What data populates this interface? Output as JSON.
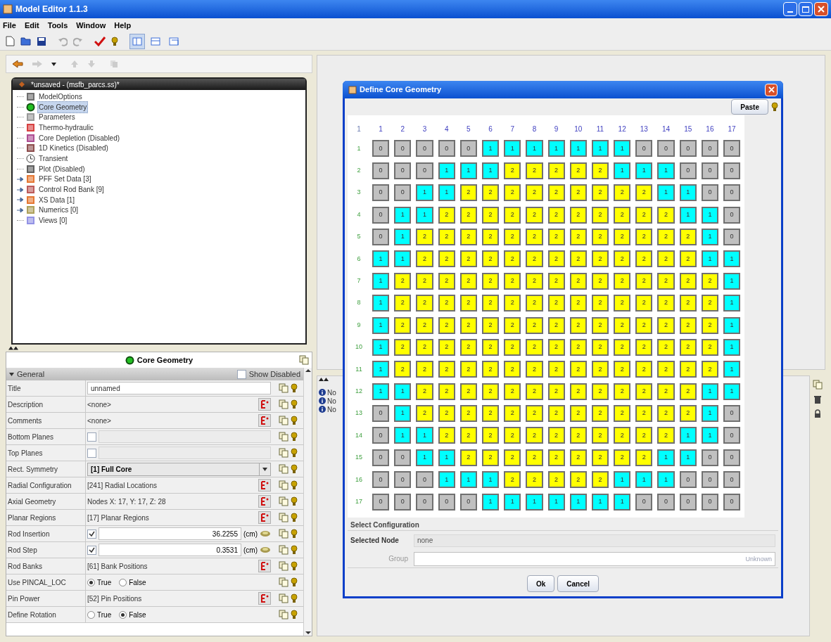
{
  "window": {
    "title": "Model Editor 1.1.3"
  },
  "menu": [
    "File",
    "Edit",
    "Tools",
    "Window",
    "Help"
  ],
  "toolbar": {
    "view_buttons": [
      {
        "selected": true
      },
      {
        "selected": false
      },
      {
        "selected": false
      }
    ]
  },
  "tree": {
    "title": "*unsaved - (msfb_parcs.ss)*",
    "items": [
      {
        "label": "ModelOptions",
        "kind": "leaf",
        "selected": false
      },
      {
        "label": "Core Geometry",
        "kind": "leaf",
        "selected": true
      },
      {
        "label": "Parameters",
        "kind": "leaf",
        "selected": false
      },
      {
        "label": "Thermo-hydraulic",
        "kind": "leaf",
        "selected": false
      },
      {
        "label": "Core Depletion (Disabled)",
        "kind": "leaf",
        "selected": false
      },
      {
        "label": "1D Kinetics (Disabled)",
        "kind": "leaf",
        "selected": false
      },
      {
        "label": "Transient",
        "kind": "leaf",
        "selected": false
      },
      {
        "label": "Plot (Disabled)",
        "kind": "leaf",
        "selected": false
      },
      {
        "label": "PFF Set Data [3]",
        "kind": "group",
        "selected": false
      },
      {
        "label": "Control Rod Bank [9]",
        "kind": "group",
        "selected": false
      },
      {
        "label": "XS Data [1]",
        "kind": "group",
        "selected": false
      },
      {
        "label": "Numerics [0]",
        "kind": "group",
        "selected": false
      },
      {
        "label": "Views [0]",
        "kind": "leaf",
        "selected": false
      }
    ]
  },
  "properties": {
    "title": "Core Geometry",
    "section": "General",
    "show_disabled": {
      "label": "Show Disabled",
      "checked": false
    },
    "rows": [
      {
        "label": "Title",
        "kind": "input",
        "value": "unnamed"
      },
      {
        "label": "Description",
        "kind": "ref",
        "value": "<none>"
      },
      {
        "label": "Comments",
        "kind": "ref",
        "value": "<none>"
      },
      {
        "label": "Bottom Planes",
        "kind": "check",
        "checked": false
      },
      {
        "label": "Top Planes",
        "kind": "check",
        "checked": false
      },
      {
        "label": "Rect. Symmetry",
        "kind": "combo",
        "value": "[1] Full Core"
      },
      {
        "label": "Radial Configuration",
        "kind": "ref",
        "value": "[241] Radial Locations"
      },
      {
        "label": "Axial Geometry",
        "kind": "ref",
        "value": "Nodes X: 17, Y: 17, Z: 28"
      },
      {
        "label": "Planar Regions",
        "kind": "ref",
        "value": "[17] Planar Regions"
      },
      {
        "label": "Rod Insertion",
        "kind": "number",
        "checked": true,
        "value": "36.2255",
        "unit": "(cm)"
      },
      {
        "label": "Rod Step",
        "kind": "number",
        "checked": true,
        "value": "0.3531",
        "unit": "(cm)"
      },
      {
        "label": "Rod Banks",
        "kind": "ref",
        "value": "[61] Bank Positions"
      },
      {
        "label": "Use PINCAL_LOC",
        "kind": "radio",
        "options": [
          {
            "label": "True",
            "selected": true
          },
          {
            "label": "False",
            "selected": false
          }
        ]
      },
      {
        "label": "Pin Power",
        "kind": "ref",
        "value": "[52] Pin Positions"
      },
      {
        "label": "Define Rotation",
        "kind": "radio",
        "options": [
          {
            "label": "True",
            "selected": false
          },
          {
            "label": "False",
            "selected": true
          }
        ]
      }
    ]
  },
  "messages": [
    "No",
    "No",
    "No"
  ],
  "dialog": {
    "title": "Define Core Geometry",
    "paste_button": "Paste",
    "corner": "1",
    "columns": [
      "1",
      "2",
      "3",
      "4",
      "5",
      "6",
      "7",
      "8",
      "9",
      "10",
      "11",
      "12",
      "13",
      "14",
      "15",
      "16",
      "17"
    ],
    "rows": [
      {
        "label": "1",
        "cells": [
          {
            "t": "0",
            "color": "#c0c0c0"
          },
          {
            "t": "0",
            "color": "#c0c0c0"
          },
          {
            "t": "0",
            "color": "#c0c0c0"
          },
          {
            "t": "0",
            "color": "#c0c0c0"
          },
          {
            "t": "0",
            "color": "#c0c0c0"
          },
          {
            "t": "1",
            "color": "#00ffff"
          },
          {
            "t": "1",
            "color": "#00ffff"
          },
          {
            "t": "1",
            "color": "#00ffff"
          },
          {
            "t": "1",
            "color": "#00ffff"
          },
          {
            "t": "1",
            "color": "#00ffff"
          },
          {
            "t": "1",
            "color": "#00ffff"
          },
          {
            "t": "1",
            "color": "#00ffff"
          },
          {
            "t": "0",
            "color": "#c0c0c0"
          },
          {
            "t": "0",
            "color": "#c0c0c0"
          },
          {
            "t": "0",
            "color": "#c0c0c0"
          },
          {
            "t": "0",
            "color": "#c0c0c0"
          },
          {
            "t": "0",
            "color": "#c0c0c0"
          }
        ]
      },
      {
        "label": "2",
        "cells": [
          {
            "t": "0",
            "color": "#c0c0c0"
          },
          {
            "t": "0",
            "color": "#c0c0c0"
          },
          {
            "t": "0",
            "color": "#c0c0c0"
          },
          {
            "t": "1",
            "color": "#00ffff"
          },
          {
            "t": "1",
            "color": "#00ffff"
          },
          {
            "t": "1",
            "color": "#00ffff"
          },
          {
            "t": "2",
            "color": "#ffff00"
          },
          {
            "t": "2",
            "color": "#ffff00"
          },
          {
            "t": "2",
            "color": "#ffff00"
          },
          {
            "t": "2",
            "color": "#ffff00"
          },
          {
            "t": "2",
            "color": "#ffff00"
          },
          {
            "t": "1",
            "color": "#00ffff"
          },
          {
            "t": "1",
            "color": "#00ffff"
          },
          {
            "t": "1",
            "color": "#00ffff"
          },
          {
            "t": "0",
            "color": "#c0c0c0"
          },
          {
            "t": "0",
            "color": "#c0c0c0"
          },
          {
            "t": "0",
            "color": "#c0c0c0"
          }
        ]
      },
      {
        "label": "3",
        "cells": [
          {
            "t": "0",
            "color": "#c0c0c0"
          },
          {
            "t": "0",
            "color": "#c0c0c0"
          },
          {
            "t": "1",
            "color": "#00ffff"
          },
          {
            "t": "1",
            "color": "#00ffff"
          },
          {
            "t": "2",
            "color": "#ffff00"
          },
          {
            "t": "2",
            "color": "#ffff00"
          },
          {
            "t": "2",
            "color": "#ffff00"
          },
          {
            "t": "2",
            "color": "#ffff00"
          },
          {
            "t": "2",
            "color": "#ffff00"
          },
          {
            "t": "2",
            "color": "#ffff00"
          },
          {
            "t": "2",
            "color": "#ffff00"
          },
          {
            "t": "2",
            "color": "#ffff00"
          },
          {
            "t": "2",
            "color": "#ffff00"
          },
          {
            "t": "1",
            "color": "#00ffff"
          },
          {
            "t": "1",
            "color": "#00ffff"
          },
          {
            "t": "0",
            "color": "#c0c0c0"
          },
          {
            "t": "0",
            "color": "#c0c0c0"
          }
        ]
      },
      {
        "label": "4",
        "cells": [
          {
            "t": "0",
            "color": "#c0c0c0"
          },
          {
            "t": "1",
            "color": "#00ffff"
          },
          {
            "t": "1",
            "color": "#00ffff"
          },
          {
            "t": "2",
            "color": "#ffff00"
          },
          {
            "t": "2",
            "color": "#ffff00"
          },
          {
            "t": "2",
            "color": "#ffff00"
          },
          {
            "t": "2",
            "color": "#ffff00"
          },
          {
            "t": "2",
            "color": "#ffff00"
          },
          {
            "t": "2",
            "color": "#ffff00"
          },
          {
            "t": "2",
            "color": "#ffff00"
          },
          {
            "t": "2",
            "color": "#ffff00"
          },
          {
            "t": "2",
            "color": "#ffff00"
          },
          {
            "t": "2",
            "color": "#ffff00"
          },
          {
            "t": "2",
            "color": "#ffff00"
          },
          {
            "t": "1",
            "color": "#00ffff"
          },
          {
            "t": "1",
            "color": "#00ffff"
          },
          {
            "t": "0",
            "color": "#c0c0c0"
          }
        ]
      },
      {
        "label": "5",
        "cells": [
          {
            "t": "0",
            "color": "#c0c0c0"
          },
          {
            "t": "1",
            "color": "#00ffff"
          },
          {
            "t": "2",
            "color": "#ffff00"
          },
          {
            "t": "2",
            "color": "#ffff00"
          },
          {
            "t": "2",
            "color": "#ffff00"
          },
          {
            "t": "2",
            "color": "#ffff00"
          },
          {
            "t": "2",
            "color": "#ffff00"
          },
          {
            "t": "2",
            "color": "#ffff00"
          },
          {
            "t": "2",
            "color": "#ffff00"
          },
          {
            "t": "2",
            "color": "#ffff00"
          },
          {
            "t": "2",
            "color": "#ffff00"
          },
          {
            "t": "2",
            "color": "#ffff00"
          },
          {
            "t": "2",
            "color": "#ffff00"
          },
          {
            "t": "2",
            "color": "#ffff00"
          },
          {
            "t": "2",
            "color": "#ffff00"
          },
          {
            "t": "1",
            "color": "#00ffff"
          },
          {
            "t": "0",
            "color": "#c0c0c0"
          }
        ]
      },
      {
        "label": "6",
        "cells": [
          {
            "t": "1",
            "color": "#00ffff"
          },
          {
            "t": "1",
            "color": "#00ffff"
          },
          {
            "t": "2",
            "color": "#ffff00"
          },
          {
            "t": "2",
            "color": "#ffff00"
          },
          {
            "t": "2",
            "color": "#ffff00"
          },
          {
            "t": "2",
            "color": "#ffff00"
          },
          {
            "t": "2",
            "color": "#ffff00"
          },
          {
            "t": "2",
            "color": "#ffff00"
          },
          {
            "t": "2",
            "color": "#ffff00"
          },
          {
            "t": "2",
            "color": "#ffff00"
          },
          {
            "t": "2",
            "color": "#ffff00"
          },
          {
            "t": "2",
            "color": "#ffff00"
          },
          {
            "t": "2",
            "color": "#ffff00"
          },
          {
            "t": "2",
            "color": "#ffff00"
          },
          {
            "t": "2",
            "color": "#ffff00"
          },
          {
            "t": "1",
            "color": "#00ffff"
          },
          {
            "t": "1",
            "color": "#00ffff"
          }
        ]
      },
      {
        "label": "7",
        "cells": [
          {
            "t": "1",
            "color": "#00ffff"
          },
          {
            "t": "2",
            "color": "#ffff00"
          },
          {
            "t": "2",
            "color": "#ffff00"
          },
          {
            "t": "2",
            "color": "#ffff00"
          },
          {
            "t": "2",
            "color": "#ffff00"
          },
          {
            "t": "2",
            "color": "#ffff00"
          },
          {
            "t": "2",
            "color": "#ffff00"
          },
          {
            "t": "2",
            "color": "#ffff00"
          },
          {
            "t": "2",
            "color": "#ffff00"
          },
          {
            "t": "2",
            "color": "#ffff00"
          },
          {
            "t": "2",
            "color": "#ffff00"
          },
          {
            "t": "2",
            "color": "#ffff00"
          },
          {
            "t": "2",
            "color": "#ffff00"
          },
          {
            "t": "2",
            "color": "#ffff00"
          },
          {
            "t": "2",
            "color": "#ffff00"
          },
          {
            "t": "2",
            "color": "#ffff00"
          },
          {
            "t": "1",
            "color": "#00ffff"
          }
        ]
      },
      {
        "label": "8",
        "cells": [
          {
            "t": "1",
            "color": "#00ffff"
          },
          {
            "t": "2",
            "color": "#ffff00"
          },
          {
            "t": "2",
            "color": "#ffff00"
          },
          {
            "t": "2",
            "color": "#ffff00"
          },
          {
            "t": "2",
            "color": "#ffff00"
          },
          {
            "t": "2",
            "color": "#ffff00"
          },
          {
            "t": "2",
            "color": "#ffff00"
          },
          {
            "t": "2",
            "color": "#ffff00"
          },
          {
            "t": "2",
            "color": "#ffff00"
          },
          {
            "t": "2",
            "color": "#ffff00"
          },
          {
            "t": "2",
            "color": "#ffff00"
          },
          {
            "t": "2",
            "color": "#ffff00"
          },
          {
            "t": "2",
            "color": "#ffff00"
          },
          {
            "t": "2",
            "color": "#ffff00"
          },
          {
            "t": "2",
            "color": "#ffff00"
          },
          {
            "t": "2",
            "color": "#ffff00"
          },
          {
            "t": "1",
            "color": "#00ffff"
          }
        ]
      },
      {
        "label": "9",
        "cells": [
          {
            "t": "1",
            "color": "#00ffff"
          },
          {
            "t": "2",
            "color": "#ffff00"
          },
          {
            "t": "2",
            "color": "#ffff00"
          },
          {
            "t": "2",
            "color": "#ffff00"
          },
          {
            "t": "2",
            "color": "#ffff00"
          },
          {
            "t": "2",
            "color": "#ffff00"
          },
          {
            "t": "2",
            "color": "#ffff00"
          },
          {
            "t": "2",
            "color": "#ffff00"
          },
          {
            "t": "2",
            "color": "#ffff00"
          },
          {
            "t": "2",
            "color": "#ffff00"
          },
          {
            "t": "2",
            "color": "#ffff00"
          },
          {
            "t": "2",
            "color": "#ffff00"
          },
          {
            "t": "2",
            "color": "#ffff00"
          },
          {
            "t": "2",
            "color": "#ffff00"
          },
          {
            "t": "2",
            "color": "#ffff00"
          },
          {
            "t": "2",
            "color": "#ffff00"
          },
          {
            "t": "1",
            "color": "#00ffff"
          }
        ]
      },
      {
        "label": "10",
        "cells": [
          {
            "t": "1",
            "color": "#00ffff"
          },
          {
            "t": "2",
            "color": "#ffff00"
          },
          {
            "t": "2",
            "color": "#ffff00"
          },
          {
            "t": "2",
            "color": "#ffff00"
          },
          {
            "t": "2",
            "color": "#ffff00"
          },
          {
            "t": "2",
            "color": "#ffff00"
          },
          {
            "t": "2",
            "color": "#ffff00"
          },
          {
            "t": "2",
            "color": "#ffff00"
          },
          {
            "t": "2",
            "color": "#ffff00"
          },
          {
            "t": "2",
            "color": "#ffff00"
          },
          {
            "t": "2",
            "color": "#ffff00"
          },
          {
            "t": "2",
            "color": "#ffff00"
          },
          {
            "t": "2",
            "color": "#ffff00"
          },
          {
            "t": "2",
            "color": "#ffff00"
          },
          {
            "t": "2",
            "color": "#ffff00"
          },
          {
            "t": "2",
            "color": "#ffff00"
          },
          {
            "t": "1",
            "color": "#00ffff"
          }
        ]
      },
      {
        "label": "11",
        "cells": [
          {
            "t": "1",
            "color": "#00ffff"
          },
          {
            "t": "2",
            "color": "#ffff00"
          },
          {
            "t": "2",
            "color": "#ffff00"
          },
          {
            "t": "2",
            "color": "#ffff00"
          },
          {
            "t": "2",
            "color": "#ffff00"
          },
          {
            "t": "2",
            "color": "#ffff00"
          },
          {
            "t": "2",
            "color": "#ffff00"
          },
          {
            "t": "2",
            "color": "#ffff00"
          },
          {
            "t": "2",
            "color": "#ffff00"
          },
          {
            "t": "2",
            "color": "#ffff00"
          },
          {
            "t": "2",
            "color": "#ffff00"
          },
          {
            "t": "2",
            "color": "#ffff00"
          },
          {
            "t": "2",
            "color": "#ffff00"
          },
          {
            "t": "2",
            "color": "#ffff00"
          },
          {
            "t": "2",
            "color": "#ffff00"
          },
          {
            "t": "2",
            "color": "#ffff00"
          },
          {
            "t": "1",
            "color": "#00ffff"
          }
        ]
      },
      {
        "label": "12",
        "cells": [
          {
            "t": "1",
            "color": "#00ffff"
          },
          {
            "t": "1",
            "color": "#00ffff"
          },
          {
            "t": "2",
            "color": "#ffff00"
          },
          {
            "t": "2",
            "color": "#ffff00"
          },
          {
            "t": "2",
            "color": "#ffff00"
          },
          {
            "t": "2",
            "color": "#ffff00"
          },
          {
            "t": "2",
            "color": "#ffff00"
          },
          {
            "t": "2",
            "color": "#ffff00"
          },
          {
            "t": "2",
            "color": "#ffff00"
          },
          {
            "t": "2",
            "color": "#ffff00"
          },
          {
            "t": "2",
            "color": "#ffff00"
          },
          {
            "t": "2",
            "color": "#ffff00"
          },
          {
            "t": "2",
            "color": "#ffff00"
          },
          {
            "t": "2",
            "color": "#ffff00"
          },
          {
            "t": "2",
            "color": "#ffff00"
          },
          {
            "t": "1",
            "color": "#00ffff"
          },
          {
            "t": "1",
            "color": "#00ffff"
          }
        ]
      },
      {
        "label": "13",
        "cells": [
          {
            "t": "0",
            "color": "#c0c0c0"
          },
          {
            "t": "1",
            "color": "#00ffff"
          },
          {
            "t": "2",
            "color": "#ffff00"
          },
          {
            "t": "2",
            "color": "#ffff00"
          },
          {
            "t": "2",
            "color": "#ffff00"
          },
          {
            "t": "2",
            "color": "#ffff00"
          },
          {
            "t": "2",
            "color": "#ffff00"
          },
          {
            "t": "2",
            "color": "#ffff00"
          },
          {
            "t": "2",
            "color": "#ffff00"
          },
          {
            "t": "2",
            "color": "#ffff00"
          },
          {
            "t": "2",
            "color": "#ffff00"
          },
          {
            "t": "2",
            "color": "#ffff00"
          },
          {
            "t": "2",
            "color": "#ffff00"
          },
          {
            "t": "2",
            "color": "#ffff00"
          },
          {
            "t": "2",
            "color": "#ffff00"
          },
          {
            "t": "1",
            "color": "#00ffff"
          },
          {
            "t": "0",
            "color": "#c0c0c0"
          }
        ]
      },
      {
        "label": "14",
        "cells": [
          {
            "t": "0",
            "color": "#c0c0c0"
          },
          {
            "t": "1",
            "color": "#00ffff"
          },
          {
            "t": "1",
            "color": "#00ffff"
          },
          {
            "t": "2",
            "color": "#ffff00"
          },
          {
            "t": "2",
            "color": "#ffff00"
          },
          {
            "t": "2",
            "color": "#ffff00"
          },
          {
            "t": "2",
            "color": "#ffff00"
          },
          {
            "t": "2",
            "color": "#ffff00"
          },
          {
            "t": "2",
            "color": "#ffff00"
          },
          {
            "t": "2",
            "color": "#ffff00"
          },
          {
            "t": "2",
            "color": "#ffff00"
          },
          {
            "t": "2",
            "color": "#ffff00"
          },
          {
            "t": "2",
            "color": "#ffff00"
          },
          {
            "t": "2",
            "color": "#ffff00"
          },
          {
            "t": "1",
            "color": "#00ffff"
          },
          {
            "t": "1",
            "color": "#00ffff"
          },
          {
            "t": "0",
            "color": "#c0c0c0"
          }
        ]
      },
      {
        "label": "15",
        "cells": [
          {
            "t": "0",
            "color": "#c0c0c0"
          },
          {
            "t": "0",
            "color": "#c0c0c0"
          },
          {
            "t": "1",
            "color": "#00ffff"
          },
          {
            "t": "1",
            "color": "#00ffff"
          },
          {
            "t": "2",
            "color": "#ffff00"
          },
          {
            "t": "2",
            "color": "#ffff00"
          },
          {
            "t": "2",
            "color": "#ffff00"
          },
          {
            "t": "2",
            "color": "#ffff00"
          },
          {
            "t": "2",
            "color": "#ffff00"
          },
          {
            "t": "2",
            "color": "#ffff00"
          },
          {
            "t": "2",
            "color": "#ffff00"
          },
          {
            "t": "2",
            "color": "#ffff00"
          },
          {
            "t": "2",
            "color": "#ffff00"
          },
          {
            "t": "1",
            "color": "#00ffff"
          },
          {
            "t": "1",
            "color": "#00ffff"
          },
          {
            "t": "0",
            "color": "#c0c0c0"
          },
          {
            "t": "0",
            "color": "#c0c0c0"
          }
        ]
      },
      {
        "label": "16",
        "cells": [
          {
            "t": "0",
            "color": "#c0c0c0"
          },
          {
            "t": "0",
            "color": "#c0c0c0"
          },
          {
            "t": "0",
            "color": "#c0c0c0"
          },
          {
            "t": "1",
            "color": "#00ffff"
          },
          {
            "t": "1",
            "color": "#00ffff"
          },
          {
            "t": "1",
            "color": "#00ffff"
          },
          {
            "t": "2",
            "color": "#ffff00"
          },
          {
            "t": "2",
            "color": "#ffff00"
          },
          {
            "t": "2",
            "color": "#ffff00"
          },
          {
            "t": "2",
            "color": "#ffff00"
          },
          {
            "t": "2",
            "color": "#ffff00"
          },
          {
            "t": "1",
            "color": "#00ffff"
          },
          {
            "t": "1",
            "color": "#00ffff"
          },
          {
            "t": "1",
            "color": "#00ffff"
          },
          {
            "t": "0",
            "color": "#c0c0c0"
          },
          {
            "t": "0",
            "color": "#c0c0c0"
          },
          {
            "t": "0",
            "color": "#c0c0c0"
          }
        ]
      },
      {
        "label": "17",
        "cells": [
          {
            "t": "0",
            "color": "#c0c0c0"
          },
          {
            "t": "0",
            "color": "#c0c0c0"
          },
          {
            "t": "0",
            "color": "#c0c0c0"
          },
          {
            "t": "0",
            "color": "#c0c0c0"
          },
          {
            "t": "0",
            "color": "#c0c0c0"
          },
          {
            "t": "1",
            "color": "#00ffff"
          },
          {
            "t": "1",
            "color": "#00ffff"
          },
          {
            "t": "1",
            "color": "#00ffff"
          },
          {
            "t": "1",
            "color": "#00ffff"
          },
          {
            "t": "1",
            "color": "#00ffff"
          },
          {
            "t": "1",
            "color": "#00ffff"
          },
          {
            "t": "1",
            "color": "#00ffff"
          },
          {
            "t": "0",
            "color": "#c0c0c0"
          },
          {
            "t": "0",
            "color": "#c0c0c0"
          },
          {
            "t": "0",
            "color": "#c0c0c0"
          },
          {
            "t": "0",
            "color": "#c0c0c0"
          },
          {
            "t": "0",
            "color": "#c0c0c0"
          }
        ]
      }
    ],
    "section": "Select Configuration",
    "selected_node": {
      "label": "Selected Node",
      "value": "none"
    },
    "group": {
      "label": "Group",
      "hint": "Unknown",
      "disabled": true
    },
    "buttons": [
      "Ok",
      "Cancel"
    ]
  }
}
